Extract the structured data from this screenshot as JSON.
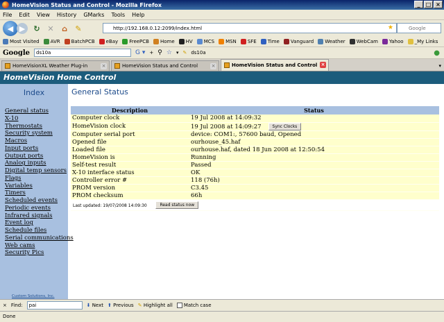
{
  "window": {
    "title": "HomeVision Status and Control - Mozilla Firefox"
  },
  "menu": [
    "File",
    "Edit",
    "View",
    "History",
    "GMarks",
    "Tools",
    "Help"
  ],
  "nav": {
    "url": "http://192.168.0.12:2099/index.html",
    "search_placeholder": "Google"
  },
  "bookmarks": [
    {
      "label": "Most Visited",
      "color": "#4a7ab8"
    },
    {
      "label": "AVR",
      "color": "#3a8a3a"
    },
    {
      "label": "BatchPCB",
      "color": "#c04020"
    },
    {
      "label": "eBay",
      "color": "#d02020"
    },
    {
      "label": "FreePCB",
      "color": "#2a9a2a"
    },
    {
      "label": "Home",
      "color": "#d08020"
    },
    {
      "label": "HV",
      "color": "#202020"
    },
    {
      "label": "MCS",
      "color": "#5a8ad0"
    },
    {
      "label": "MSN",
      "color": "#f08000"
    },
    {
      "label": "SFE",
      "color": "#d02020"
    },
    {
      "label": "Time",
      "color": "#3060c0"
    },
    {
      "label": "Vanguard",
      "color": "#902020"
    },
    {
      "label": "Weather",
      "color": "#5080b0"
    },
    {
      "label": "WebCam",
      "color": "#303030"
    },
    {
      "label": "Yahoo",
      "color": "#7a2a9a"
    },
    {
      "label": "_My Links",
      "color": "#e0c040"
    }
  ],
  "googlebar": {
    "logo": "Google",
    "query": "ds10a",
    "query_btn": "ds10a"
  },
  "tabs": [
    {
      "label": "HomeVisionXL Weather Plug-in",
      "active": false
    },
    {
      "label": "HomeVision Status and Control",
      "active": false
    },
    {
      "label": "HomeVision Status and Control",
      "active": true
    }
  ],
  "page": {
    "header": "HomeVision Home Control",
    "index_title": "Index",
    "sidebar_links": [
      "General status",
      "X-10",
      "Thermostats",
      "Security system",
      "Macros",
      "Input ports",
      "Output ports",
      "Analog inputs",
      "Digital temp sensors",
      "Flags",
      "Variables",
      "Timers",
      "Scheduled events",
      "Periodic events",
      "Infrared signals",
      "Event log",
      "Schedule files",
      "Serial communications",
      "Web cams",
      "Security Pics"
    ],
    "credit": "Custom Solutions, Inc.",
    "title": "General Status",
    "table": {
      "headers": [
        "Description",
        "Status"
      ],
      "rows": [
        {
          "desc": "Computer clock",
          "value": "19 Jul 2008 at 14:09:32"
        },
        {
          "desc": "HomeVision clock",
          "value": "19 Jul 2008 at 14:09:27",
          "button": "Sync Clocks"
        },
        {
          "desc": "Computer serial port",
          "value": "device: COM1:, 57600 baud, Opened"
        },
        {
          "desc": "Opened file",
          "value": "ourhouse_45.haf"
        },
        {
          "desc": "Loaded file",
          "value": "ourhouse.haf, dated 18 Jun 2008 at 12:50:54"
        },
        {
          "desc": "HomeVision is",
          "value": "Running"
        },
        {
          "desc": "Self-test result",
          "value": "Passed"
        },
        {
          "desc": "X-10 interface status",
          "value": "OK"
        },
        {
          "desc": "Controller error #",
          "value": "118 (76h)"
        },
        {
          "desc": "PROM version",
          "value": "C3.45"
        },
        {
          "desc": "PROM checksum",
          "value": "66h"
        }
      ],
      "last_updated": "Last updated: 19/07/2008 14:09:30",
      "read_button": "Read status now"
    }
  },
  "findbar": {
    "label": "Find:",
    "value": "pai",
    "next": "Next",
    "previous": "Previous",
    "highlight": "Highlight all",
    "match_case": "Match case"
  },
  "status": "Done"
}
